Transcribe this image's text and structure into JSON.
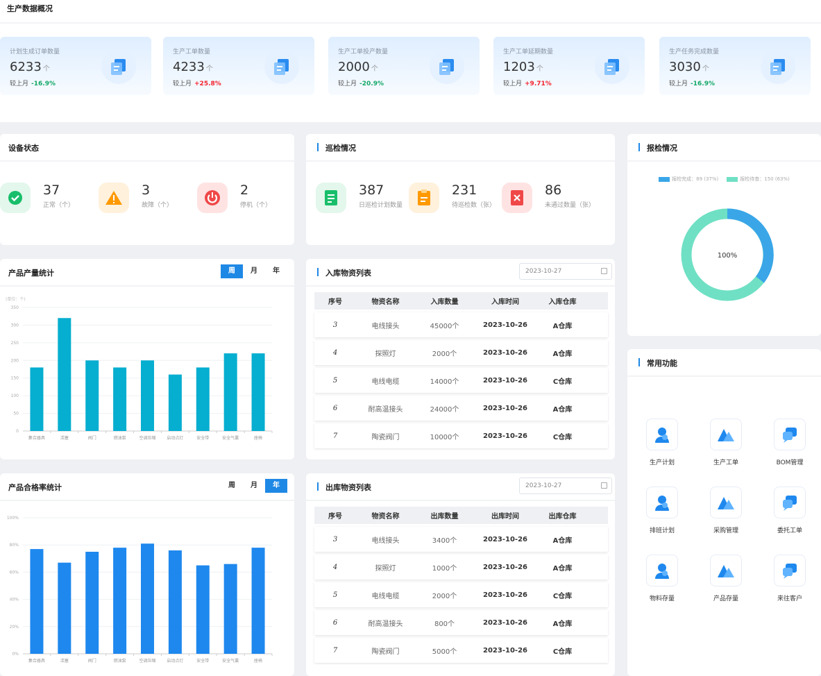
{
  "page_title": "生产数据概况",
  "stats": [
    {
      "label": "计划生成订单数量",
      "value": "6233",
      "unit": "个",
      "compare_label": "较上月",
      "change": "-16.9%",
      "trend": "down"
    },
    {
      "label": "生产工单数量",
      "value": "4233",
      "unit": "个",
      "compare_label": "较上月",
      "change": "+25.8%",
      "trend": "up"
    },
    {
      "label": "生产工单投产数量",
      "value": "2000",
      "unit": "个",
      "compare_label": "较上月",
      "change": "-20.9%",
      "trend": "down"
    },
    {
      "label": "生产工单延期数量",
      "value": "1203",
      "unit": "个",
      "compare_label": "较上月",
      "change": "+9.71%",
      "trend": "up"
    },
    {
      "label": "生产任务完成数量",
      "value": "3030",
      "unit": "个",
      "compare_label": "较上月",
      "change": "-16.9%",
      "trend": "down"
    }
  ],
  "device_status": {
    "title": "设备状态",
    "items": [
      {
        "value": "37",
        "label": "正常（个）",
        "icon": "check-icon",
        "bg": "#e3f7ec",
        "color": "#19be6b"
      },
      {
        "value": "3",
        "label": "故障（个）",
        "icon": "warning-icon",
        "bg": "#fff1dc",
        "color": "#ff9900"
      },
      {
        "value": "2",
        "label": "停机（个）",
        "icon": "power-icon",
        "bg": "#ffe3e3",
        "color": "#f04848"
      }
    ]
  },
  "inspection": {
    "title": "巡检情况",
    "items": [
      {
        "value": "387",
        "label": "日巡检计划数量",
        "icon": "document-icon",
        "bg": "#e3f7ec",
        "color": "#19be6b"
      },
      {
        "value": "231",
        "label": "待巡检数（张）",
        "icon": "clipboard-icon",
        "bg": "#fff1dc",
        "color": "#ff9900"
      },
      {
        "value": "86",
        "label": "未通过数量（张）",
        "icon": "reject-icon",
        "bg": "#ffe3e3",
        "color": "#f04848"
      }
    ]
  },
  "report": {
    "title": "报检情况",
    "legend": [
      {
        "label": "报检完成：89 (37%)",
        "color": "#3aa6e8"
      },
      {
        "label": "报检待查：150 (63%)",
        "color": "#6fe0c4"
      }
    ],
    "center_label": "100%"
  },
  "output_chart": {
    "title": "产品产量统计",
    "tabs": [
      "周",
      "月",
      "年"
    ],
    "active_tab": 0,
    "unit": "(单位：个)"
  },
  "quality_chart": {
    "title": "产品合格率统计",
    "tabs": [
      "周",
      "月",
      "年"
    ],
    "active_tab": 2
  },
  "chart_data": [
    {
      "type": "bar",
      "title": "产品产量统计",
      "ylabel": "(单位：个)",
      "categories": [
        "集合器具",
        "活塞",
        "阀门",
        "燃油泵",
        "空调压缩",
        "启动点灯",
        "安全带",
        "安全气囊",
        "座椅"
      ],
      "values": [
        180,
        320,
        200,
        180,
        200,
        160,
        180,
        220,
        220
      ],
      "ylim": [
        0,
        350
      ],
      "yticks": [
        0,
        50,
        100,
        150,
        200,
        250,
        300,
        350
      ],
      "color": "#06aed0"
    },
    {
      "type": "bar",
      "title": "产品合格率统计",
      "categories": [
        "集合器具",
        "活塞",
        "阀门",
        "燃油泵",
        "空调压缩",
        "启动点灯",
        "安全带",
        "安全气囊",
        "座椅"
      ],
      "values": [
        77,
        67,
        75,
        78,
        81,
        76,
        65,
        66,
        78
      ],
      "ylim": [
        0,
        100
      ],
      "yticks": [
        "0%",
        "20%",
        "40%",
        "60%",
        "80%",
        "100%"
      ],
      "color": "#1e88ee"
    }
  ],
  "inbound": {
    "title": "入库物资列表",
    "date": "2023-10-27",
    "columns": [
      "序号",
      "物资名称",
      "入库数量",
      "入库时间",
      "入库仓库"
    ],
    "rows": [
      [
        "3",
        "电线接头",
        "45000个",
        "2023-10-26",
        "A仓库"
      ],
      [
        "4",
        "探照灯",
        "2000个",
        "2023-10-26",
        "A仓库"
      ],
      [
        "5",
        "电线电缆",
        "14000个",
        "2023-10-26",
        "C仓库"
      ],
      [
        "6",
        "耐高温接头",
        "24000个",
        "2023-10-26",
        "A仓库"
      ],
      [
        "7",
        "陶瓷阀门",
        "10000个",
        "2023-10-26",
        "C仓库"
      ]
    ]
  },
  "outbound": {
    "title": "出库物资列表",
    "date": "2023-10-27",
    "columns": [
      "序号",
      "物资名称",
      "出库数量",
      "出库时间",
      "出库仓库"
    ],
    "rows": [
      [
        "3",
        "电线接头",
        "3400个",
        "2023-10-26",
        "A仓库"
      ],
      [
        "4",
        "探照灯",
        "1000个",
        "2023-10-26",
        "A仓库"
      ],
      [
        "5",
        "电线电缆",
        "2000个",
        "2023-10-26",
        "C仓库"
      ],
      [
        "6",
        "耐高温接头",
        "800个",
        "2023-10-26",
        "A仓库"
      ],
      [
        "7",
        "陶瓷阀门",
        "5000个",
        "2023-10-26",
        "C仓库"
      ]
    ]
  },
  "functions": {
    "title": "常用功能",
    "items": [
      {
        "label": "生产计划",
        "icon": "person-icon"
      },
      {
        "label": "生产工单",
        "icon": "mountain-icon"
      },
      {
        "label": "BOM管理",
        "icon": "chat-icon"
      },
      {
        "label": "排班计划",
        "icon": "person-icon"
      },
      {
        "label": "采购管理",
        "icon": "mountain-icon"
      },
      {
        "label": "委托工单",
        "icon": "chat-icon"
      },
      {
        "label": "物料存量",
        "icon": "person-icon"
      },
      {
        "label": "产品存量",
        "icon": "mountain-icon"
      },
      {
        "label": "来往客户",
        "icon": "chat-icon"
      }
    ]
  }
}
